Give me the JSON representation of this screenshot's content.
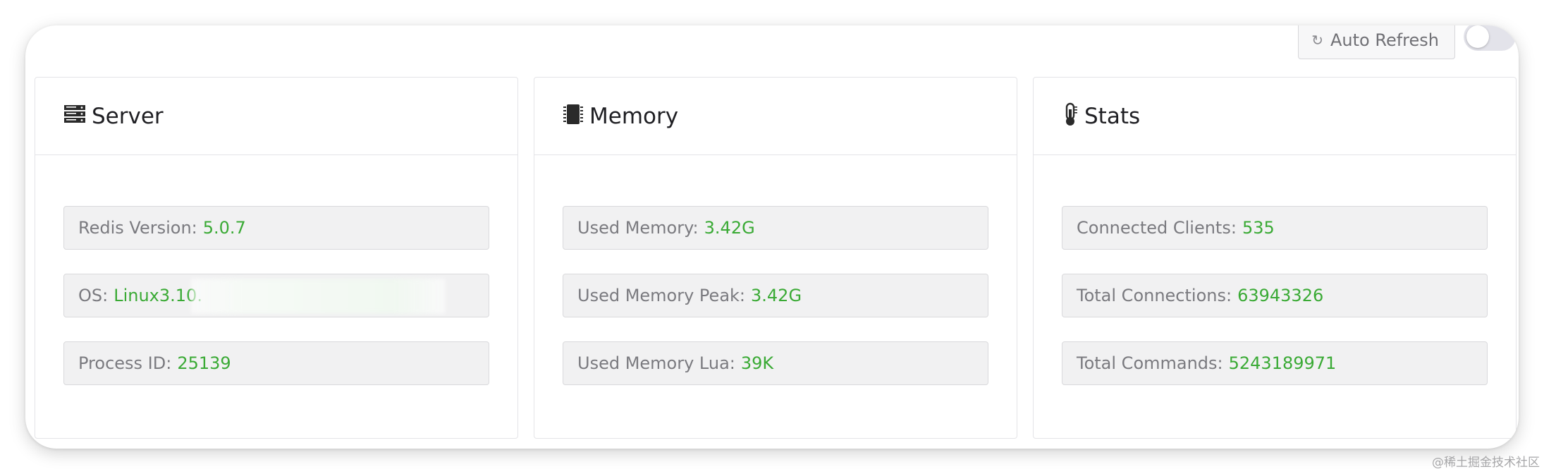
{
  "toolbar": {
    "refresh_icon": "refresh-icon",
    "refresh_label": "Auto Refresh",
    "auto_refresh_enabled": false
  },
  "panels": [
    {
      "icon": "server-icon",
      "title": "Server",
      "rows": [
        {
          "label": "Redis Version:",
          "value": "5.0.7"
        },
        {
          "label": "OS:",
          "value": "Linux3.10."
        },
        {
          "label": "Process ID:",
          "value": "25139"
        }
      ]
    },
    {
      "icon": "chip-icon",
      "title": "Memory",
      "rows": [
        {
          "label": "Used Memory:",
          "value": "3.42G"
        },
        {
          "label": "Used Memory Peak:",
          "value": "3.42G"
        },
        {
          "label": "Used Memory Lua:",
          "value": "39K"
        }
      ]
    },
    {
      "icon": "thermometer-icon",
      "title": "Stats",
      "rows": [
        {
          "label": "Connected Clients:",
          "value": "535"
        },
        {
          "label": "Total Connections:",
          "value": "63943326"
        },
        {
          "label": "Total Commands:",
          "value": "5243189971"
        }
      ]
    }
  ],
  "colors": {
    "value": "#3aaa35",
    "label": "#7a7a7f",
    "row_bg": "#f1f1f2",
    "border": "#e4e4e7"
  },
  "watermark": "@稀土掘金技术社区"
}
